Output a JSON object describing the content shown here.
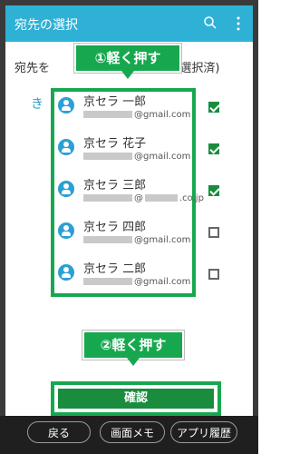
{
  "app": {
    "title": "宛先の選択",
    "subtitle_prefix": "宛先を",
    "subtitle_suffix": "件 選択済)",
    "section_letter": "き",
    "search_icon": "search-icon",
    "more_icon": "more-vert-icon",
    "accent_color": "#2fb1d6"
  },
  "callouts": {
    "step1": "①軽く押す",
    "step2": "②軽く押す"
  },
  "contacts": [
    {
      "name": "京セラ 一郎",
      "email_domain": "@gmail.com",
      "checked": true
    },
    {
      "name": "京セラ 花子",
      "email_domain": "@gmail.com",
      "checked": true
    },
    {
      "name": "京セラ 三郎",
      "email_domain": ".co.jp",
      "checked": true
    },
    {
      "name": "京セラ 四郎",
      "email_domain": "@gmail.com",
      "checked": false
    },
    {
      "name": "京セラ 二郎",
      "email_domain": "@gmail.com",
      "checked": false
    }
  ],
  "confirm": {
    "label": "確認"
  },
  "bottom_nav": {
    "back": "戻る",
    "memo": "画面メモ",
    "history": "アプリ履歴"
  }
}
